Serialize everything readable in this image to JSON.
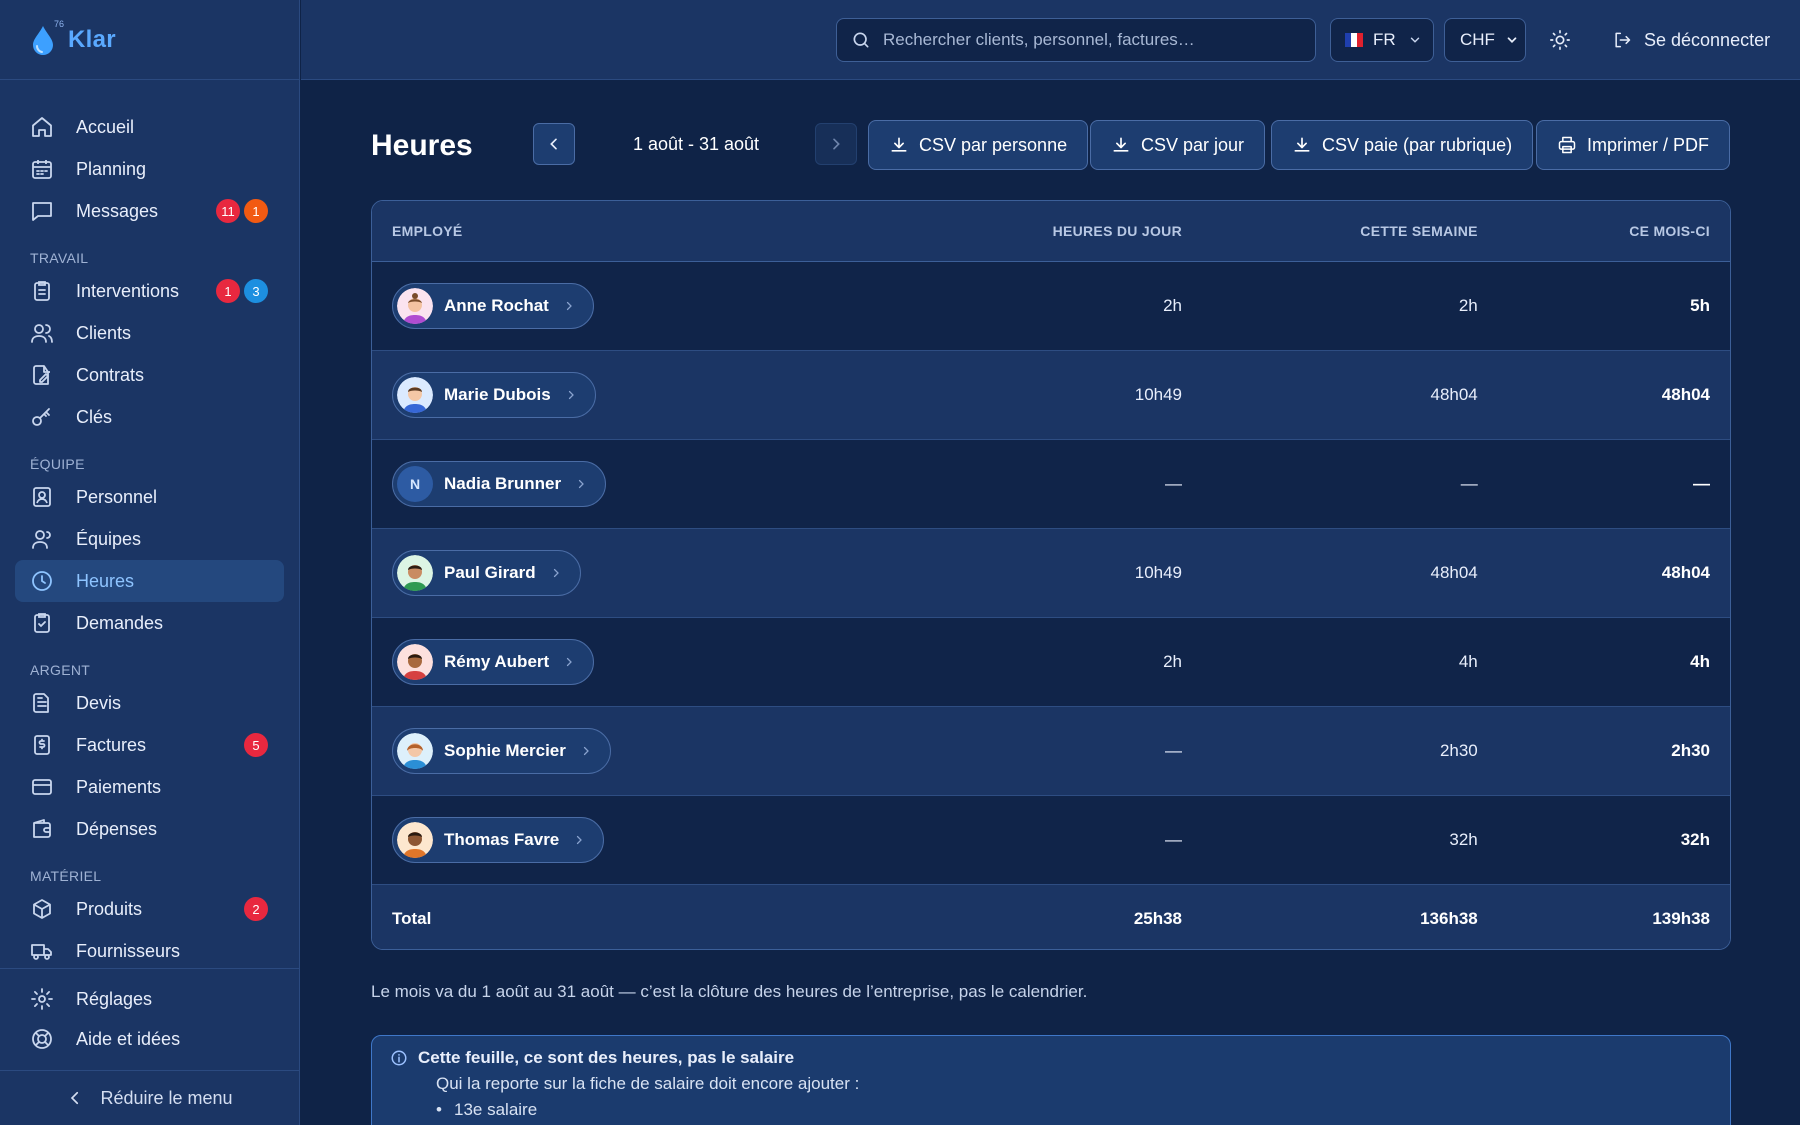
{
  "app": {
    "name": "Klar",
    "logo_sup": "76"
  },
  "topbar": {
    "search_placeholder": "Rechercher clients, personnel, factures…",
    "language": "FR",
    "currency": "CHF",
    "logout_label": "Se déconnecter"
  },
  "sidebar": {
    "items": {
      "accueil": {
        "label": "Accueil"
      },
      "planning": {
        "label": "Planning"
      },
      "messages": {
        "label": "Messages",
        "badges": [
          "11",
          "1"
        ]
      },
      "interventions": {
        "label": "Interventions",
        "badges": [
          "1",
          "3"
        ]
      },
      "clients": {
        "label": "Clients"
      },
      "contrats": {
        "label": "Contrats"
      },
      "cles": {
        "label": "Clés"
      },
      "personnel": {
        "label": "Personnel"
      },
      "equipes": {
        "label": "Équipes"
      },
      "heures": {
        "label": "Heures",
        "active": true
      },
      "demandes": {
        "label": "Demandes"
      },
      "devis": {
        "label": "Devis"
      },
      "factures": {
        "label": "Factures",
        "badges": [
          "5"
        ]
      },
      "paiements": {
        "label": "Paiements"
      },
      "depenses": {
        "label": "Dépenses"
      },
      "produits": {
        "label": "Produits",
        "badges": [
          "2"
        ]
      },
      "fournisseurs": {
        "label": "Fournisseurs"
      },
      "reglages": {
        "label": "Réglages"
      },
      "aide": {
        "label": "Aide et idées"
      }
    },
    "sections": {
      "travail": "TRAVAIL",
      "equipe": "ÉQUIPE",
      "argent": "ARGENT",
      "materiel": "MATÉRIEL"
    },
    "collapse_label": "Réduire le menu"
  },
  "page": {
    "title": "Heures",
    "date_range": "1 août - 31 août",
    "actions": {
      "csv_person": "CSV par personne",
      "csv_day": "CSV par jour",
      "csv_payroll": "CSV paie (par rubrique)",
      "print": "Imprimer / PDF"
    },
    "table": {
      "headers": {
        "employee": "EMPLOYÉ",
        "day": "HEURES DU JOUR",
        "week": "CETTE SEMAINE",
        "month": "CE MOIS-CI"
      },
      "rows": [
        {
          "name": "Anne Rochat",
          "day": "2h",
          "week": "2h",
          "month": "5h",
          "avatar": "woman-bun"
        },
        {
          "name": "Marie Dubois",
          "day": "10h49",
          "week": "48h04",
          "month": "48h04",
          "avatar": "man-blue"
        },
        {
          "name": "Nadia Brunner",
          "day": "—",
          "week": "—",
          "month": "—",
          "avatar": "initial",
          "initial": "N"
        },
        {
          "name": "Paul Girard",
          "day": "10h49",
          "week": "48h04",
          "month": "48h04",
          "avatar": "man-green"
        },
        {
          "name": "Rémy Aubert",
          "day": "2h",
          "week": "4h",
          "month": "4h",
          "avatar": "man-red"
        },
        {
          "name": "Sophie Mercier",
          "day": "—",
          "week": "2h30",
          "month": "2h30",
          "avatar": "woman-blue"
        },
        {
          "name": "Thomas Favre",
          "day": "—",
          "week": "32h",
          "month": "32h",
          "avatar": "man-orange"
        }
      ],
      "total": {
        "label": "Total",
        "day": "25h38",
        "week": "136h38",
        "month": "139h38"
      }
    },
    "note": "Le mois va du 1 août au 31 août — c’est la clôture des heures de l’entreprise, pas le calendrier.",
    "info": {
      "title": "Cette feuille, ce sont des heures, pas le salaire",
      "text": "Qui la reporte sur la fiche de salaire doit encore ajouter :",
      "items": [
        "13e salaire"
      ]
    }
  },
  "colors": {
    "background": "#0f2347",
    "panel": "#1b3564",
    "accent": "#5aa9ff",
    "active_text": "#8ec4ff",
    "badge_red": "#e8283f",
    "badge_orange": "#f25a12",
    "badge_blue": "#1d8fe0"
  }
}
